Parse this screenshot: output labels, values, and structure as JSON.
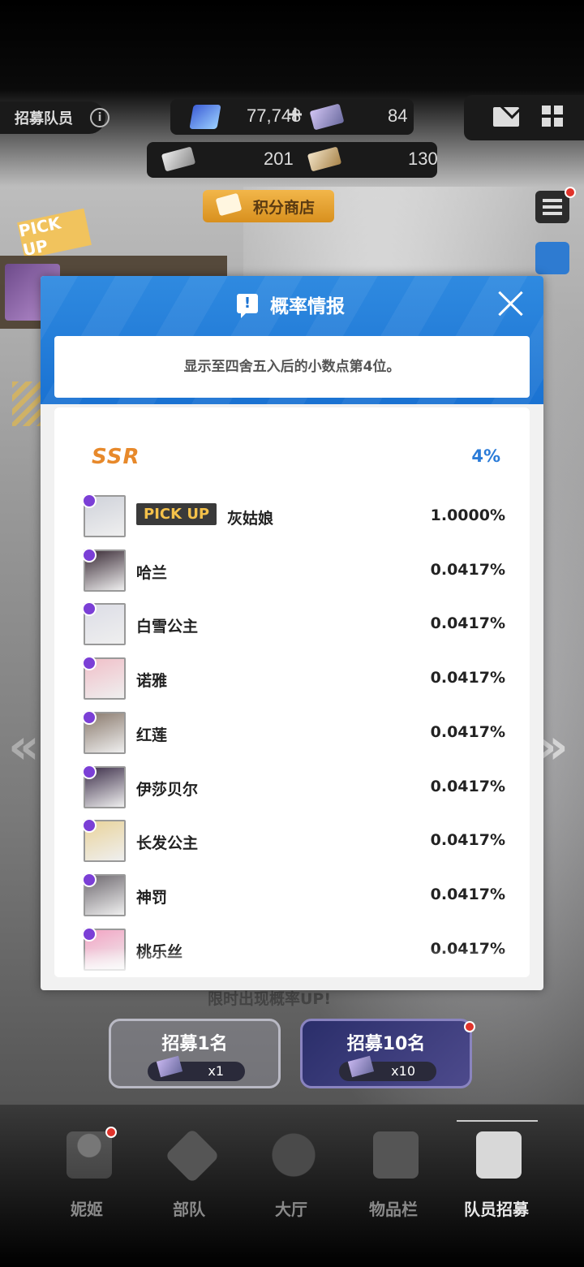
{
  "header": {
    "title": "招募队员",
    "info_icon": "info-icon",
    "gems": "77,748",
    "cards": "84",
    "tickets": "201",
    "gold_tickets": "130",
    "plus": "+"
  },
  "shop": {
    "label": "积分商店"
  },
  "banner": {
    "pickup_tag": "PICK UP"
  },
  "modal": {
    "title": "概率情报",
    "note": "显示至四舍五入后的小数点第4位。",
    "tier": {
      "label": "SSR",
      "rate": "4%"
    },
    "pickup_badge": "PICK UP",
    "rows": [
      {
        "name": "灰姑娘",
        "rate": "1.0000%",
        "pickup": true
      },
      {
        "name": "哈兰",
        "rate": "0.0417%"
      },
      {
        "name": "白雪公主",
        "rate": "0.0417%"
      },
      {
        "name": "诺雅",
        "rate": "0.0417%"
      },
      {
        "name": "红莲",
        "rate": "0.0417%"
      },
      {
        "name": "伊莎贝尔",
        "rate": "0.0417%"
      },
      {
        "name": "长发公主",
        "rate": "0.0417%"
      },
      {
        "name": "神罚",
        "rate": "0.0417%"
      },
      {
        "name": "桃乐丝",
        "rate": "0.0417%"
      }
    ]
  },
  "recruit": {
    "limit_text": "限时出现概率UP!",
    "one_label": "招募1名",
    "one_cost": "x1",
    "ten_label": "招募10名",
    "ten_cost": "x10"
  },
  "nav": {
    "items": [
      {
        "label": "妮姬",
        "icon": "nikke-icon"
      },
      {
        "label": "部队",
        "icon": "squad-icon"
      },
      {
        "label": "大厅",
        "icon": "lobby-icon"
      },
      {
        "label": "物品栏",
        "icon": "inventory-icon"
      },
      {
        "label": "队员招募",
        "icon": "recruit-icon"
      }
    ]
  },
  "colors": {
    "accent": "#1a72d2",
    "ssr": "#e7892b",
    "rate": "#2a7bd8",
    "pickup": "#f4c14a"
  }
}
